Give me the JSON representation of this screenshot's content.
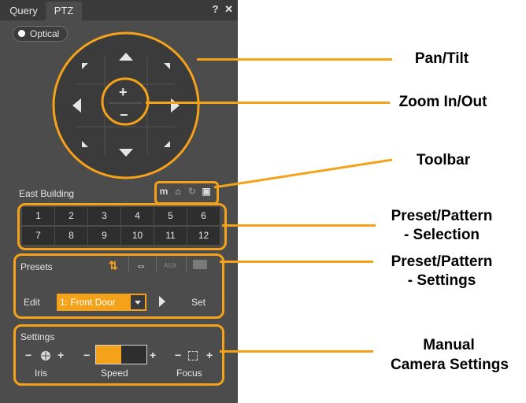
{
  "tabs": [
    {
      "label": "Query"
    },
    {
      "label": "PTZ"
    }
  ],
  "window_controls": {
    "help": "?",
    "close": "✕"
  },
  "optical": {
    "label": "Optical"
  },
  "zoom": {
    "plus": "+",
    "minus": "−"
  },
  "camera_name": "East Building",
  "toolbar_icons": [
    "mount-icon",
    "home-icon",
    "refresh-icon",
    "lock-icon"
  ],
  "presets_grid": [
    "1",
    "2",
    "3",
    "4",
    "5",
    "6",
    "7",
    "8",
    "9",
    "10",
    "11",
    "12"
  ],
  "preset_settings": {
    "title": "Presets",
    "edit_label": "Edit",
    "selected": "1: Front Door",
    "set_label": "Set",
    "aux_label": "AUX"
  },
  "settings": {
    "title": "Settings",
    "iris_label": "Iris",
    "speed_label": "Speed",
    "focus_label": "Focus",
    "minus": "−",
    "plus": "+",
    "speed_level": 0.5
  },
  "annotations": {
    "pan_tilt": "Pan/Tilt",
    "zoom": "Zoom In/Out",
    "toolbar": "Toolbar",
    "preset_selection_1": "Preset/Pattern",
    "preset_selection_2": "- Selection",
    "preset_settings_1": "Preset/Pattern",
    "preset_settings_2": "- Settings",
    "manual_1": "Manual",
    "manual_2": "Camera Settings"
  },
  "colors": {
    "accent": "#f5a21b",
    "panel": "#4c4c4c",
    "button": "#2e2e2e",
    "text": "#e6e6e6"
  }
}
